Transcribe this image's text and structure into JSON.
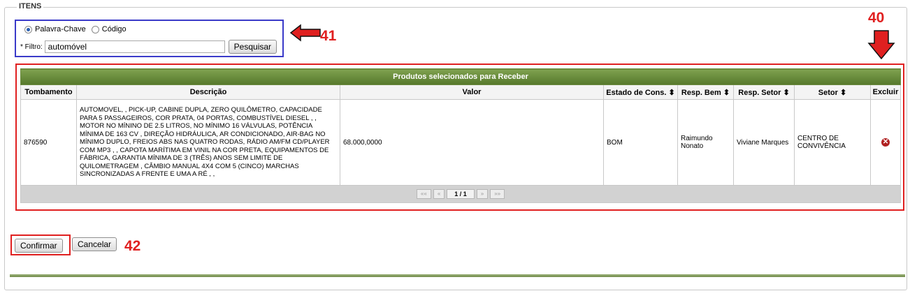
{
  "section": {
    "legend": "ITENS"
  },
  "search": {
    "radio_keyword": "Palavra-Chave",
    "radio_code": "Código",
    "selected": "Palavra-Chave",
    "filter_label": "* Filtro:",
    "filter_value": "automóvel",
    "search_button": "Pesquisar"
  },
  "annotations": {
    "a40": "40",
    "a41": "41",
    "a42": "42"
  },
  "table": {
    "caption": "Produtos selecionados para Receber",
    "headers": {
      "tombamento": "Tombamento",
      "descricao": "Descrição",
      "valor": "Valor",
      "estado": "Estado de Cons. ⬍",
      "resp_bem": "Resp. Bem ⬍",
      "resp_setor": "Resp. Setor ⬍",
      "setor": "Setor ⬍",
      "excluir": "Excluir"
    },
    "rows": [
      {
        "tombamento": "876590",
        "descricao": "AUTOMOVEL, , PICK-UP, CABINE DUPLA, ZERO QUILÔMETRO, CAPACIDADE PARA 5 PASSAGEIROS, COR PRATA, 04 PORTAS, COMBUSTÍVEL DIESEL , , MOTOR NO MÍNINO DE 2.5 LITROS, NO MÍNIMO 16 VÁLVULAS, POTÊNCIA MÍNIMA DE 163 CV , DIREÇÃO HIDRÁULICA, AR CONDICIONADO, AIR-BAG NO MÍNIMO DUPLO, FREIOS ABS NAS QUATRO RODAS, RÁDIO AM/FM CD/PLAYER COM MP3 , , CAPOTA MARÍTIMA EM VINIL NA COR PRETA, EQUIPAMENTOS DE FÁBRICA, GARANTIA MÍNIMA DE 3 (TRÊS) ANOS SEM LIMITE DE QUILOMETRAGEM , CÂMBIO MANUAL 4X4 COM 5 (CINCO) MARCHAS SINCRONIZADAS A FRENTE E UMA A RÉ , ,",
        "valor": "68.000,0000",
        "estado": "BOM",
        "resp_bem": "Raimundo Nonato",
        "resp_setor": "Viviane Marques",
        "setor": "CENTRO DE CONVIVÊNCIA"
      }
    ],
    "pager": {
      "first": "««",
      "prev": "«",
      "page": "1 / 1",
      "next": "»",
      "last": "»»"
    }
  },
  "actions": {
    "confirm": "Confirmar",
    "cancel": "Cancelar"
  },
  "colors": {
    "annotation_red": "#e02020",
    "search_box_blue": "#3a3ac9",
    "header_green": "#6b8a3f"
  }
}
